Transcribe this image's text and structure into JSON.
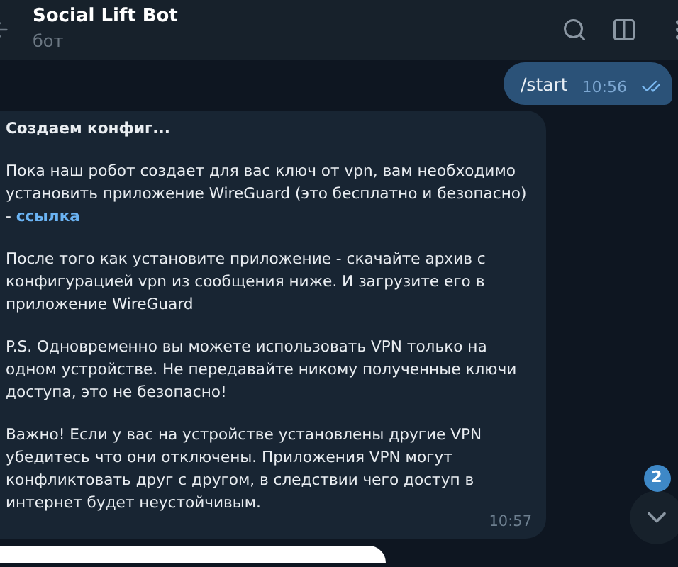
{
  "header": {
    "title": "Social Lift Bot",
    "subtitle": "бот"
  },
  "messages": [
    {
      "kind": "outgoing",
      "text": "/start",
      "time": "10:56",
      "read": true
    },
    {
      "kind": "incoming",
      "title": "Создаем конфиг...",
      "paragraphs": [
        {
          "text": "Пока наш робот создает для вас ключ от vpn, вам необходимо установить приложение WireGuard (это бесплатно и безопасно) -",
          "link": "ссылка"
        },
        {
          "text": "После того как установите приложение - скачайте архив с конфигурацией vpn из сообщения ниже. И загрузите его в приложение WireGuard"
        },
        {
          "text": "P.S. Одновременно вы можете использовать VPN только на одном устройстве. Не передавайте никому полученные ключи доступа, это не безопасно!"
        },
        {
          "text": "Важно! Если у вас на устройстве установлены другие VPN убедитесь что они отключены. Приложения VPN могут конфликтовать друг с другом, в следствии чего доступ в интернет будет неустойчивым."
        }
      ],
      "time": "10:57"
    }
  ],
  "scroll_button": {
    "badge": "2"
  }
}
